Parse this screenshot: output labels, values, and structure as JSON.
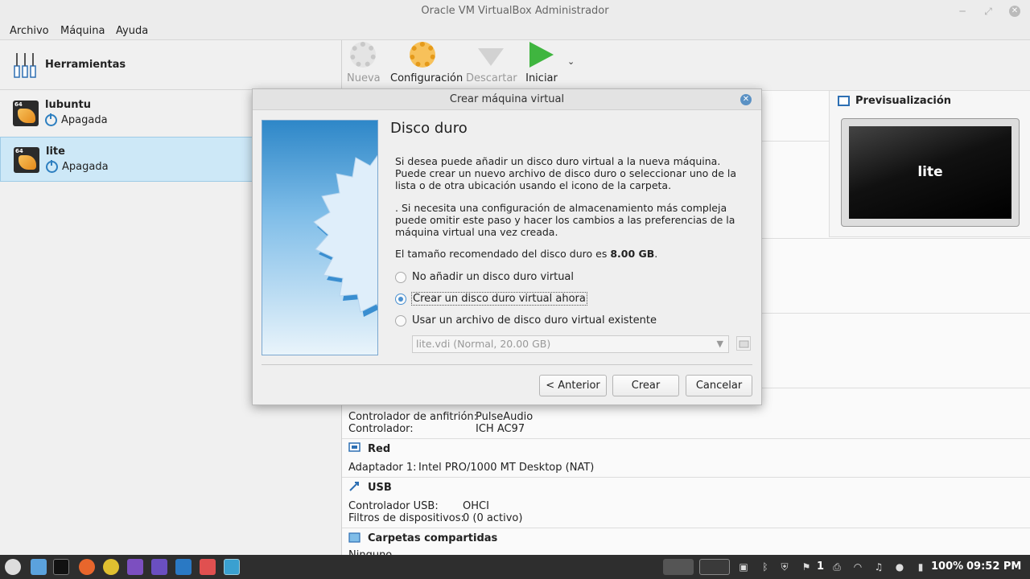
{
  "window": {
    "title": "Oracle VM VirtualBox Administrador"
  },
  "menu": [
    "Archivo",
    "Máquina",
    "Ayuda"
  ],
  "tools": {
    "label": "Herramientas"
  },
  "vms": [
    {
      "name": "lubuntu",
      "state": "Apagada",
      "badge": "64"
    },
    {
      "name": "lite",
      "state": "Apagada",
      "badge": "64"
    }
  ],
  "toolbar": {
    "new": "Nueva",
    "settings": "Configuración",
    "discard": "Descartar",
    "start": "Iniciar"
  },
  "preview": {
    "title": "Previsualización",
    "screen_text": "lite"
  },
  "details": {
    "audio": {
      "host_label": "Controlador de anfitrión:",
      "host_value": "PulseAudio",
      "ctrl_label": "Controlador:",
      "ctrl_value": "ICH AC97"
    },
    "network": {
      "title": "Red",
      "adapter_label": "Adaptador 1:",
      "adapter_value": "Intel PRO/1000 MT Desktop (NAT)"
    },
    "usb": {
      "title": "USB",
      "ctrl_label": "Controlador USB:",
      "ctrl_value": "OHCI",
      "filters_label": "Filtros de dispositivos:",
      "filters_value": "0 (0 activo)"
    },
    "shared": {
      "title": "Carpetas compartidas",
      "value": "Ninguno"
    }
  },
  "dialog": {
    "title": "Crear máquina virtual",
    "heading": "Disco duro",
    "para1": "Si desea puede añadir un disco duro virtual a la nueva máquina. Puede crear un nuevo archivo de disco duro o seleccionar uno de la lista o de otra ubicación usando el icono de la carpeta.",
    "para2": ". Si necesita una configuración de almacenamiento más compleja puede omitir este paso y hacer los cambios a las preferencias de la máquina virtual una vez creada.",
    "size_prefix": "El tamaño recomendado del disco duro es ",
    "size_value": "8.00 GB",
    "size_suffix": ".",
    "options": [
      {
        "label": "No añadir un disco duro virtual",
        "checked": false
      },
      {
        "label": "Crear un disco duro virtual ahora",
        "checked": true
      },
      {
        "label": "Usar un archivo de disco duro virtual existente",
        "checked": false
      }
    ],
    "existing_file": "lite.vdi (Normal, 20.00 GB)",
    "buttons": {
      "back": "< Anterior",
      "create": "Crear",
      "cancel": "Cancelar"
    }
  },
  "taskbar": {
    "battery": "100%",
    "time": "09:52 PM",
    "notifications": "1"
  }
}
